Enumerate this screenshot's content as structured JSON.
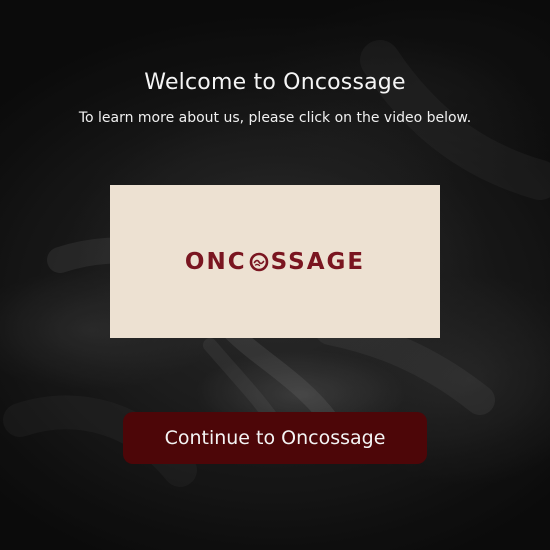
{
  "header": {
    "title": "Welcome to Oncossage",
    "subtitle": "To learn more about us, please click on the video below."
  },
  "video": {
    "logo_text_before": "ONC",
    "logo_text_after": "SSAGE",
    "logo_color": "#7a1520",
    "background_color": "#ede1d2"
  },
  "cta": {
    "label": "Continue to Oncossage",
    "color": "#4d0608"
  }
}
